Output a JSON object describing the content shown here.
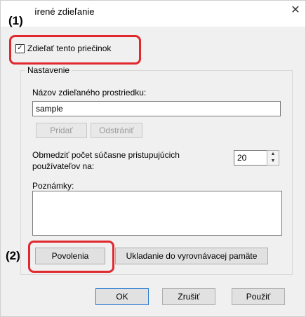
{
  "window": {
    "title": "írené zdieľanie",
    "close_glyph": "✕"
  },
  "markers": {
    "one": "(1)",
    "two": "(2)"
  },
  "share_checkbox": {
    "label": "Zdieľať tento priečinok",
    "checked": true
  },
  "settings": {
    "group_label": "Nastavenie",
    "share_name_label": "Názov zdieľaného prostriedku:",
    "share_name_value": "sample",
    "add_label": "Pridať",
    "remove_label": "Odstrániť",
    "limit_label_line1": "Obmedziť počet súčasne pristupujúcich",
    "limit_label_line2": "používateľov na:",
    "limit_value": "20",
    "comments_label": "Poznámky:",
    "comments_value": "",
    "permissions_label": "Povolenia",
    "caching_label": "Ukladanie do vyrovnávacej pamäte"
  },
  "footer": {
    "ok_label": "OK",
    "cancel_label": "Zrušiť",
    "apply_label": "Použiť"
  },
  "colors": {
    "highlight": "#e0292f",
    "panel": "#f0f0f0"
  }
}
